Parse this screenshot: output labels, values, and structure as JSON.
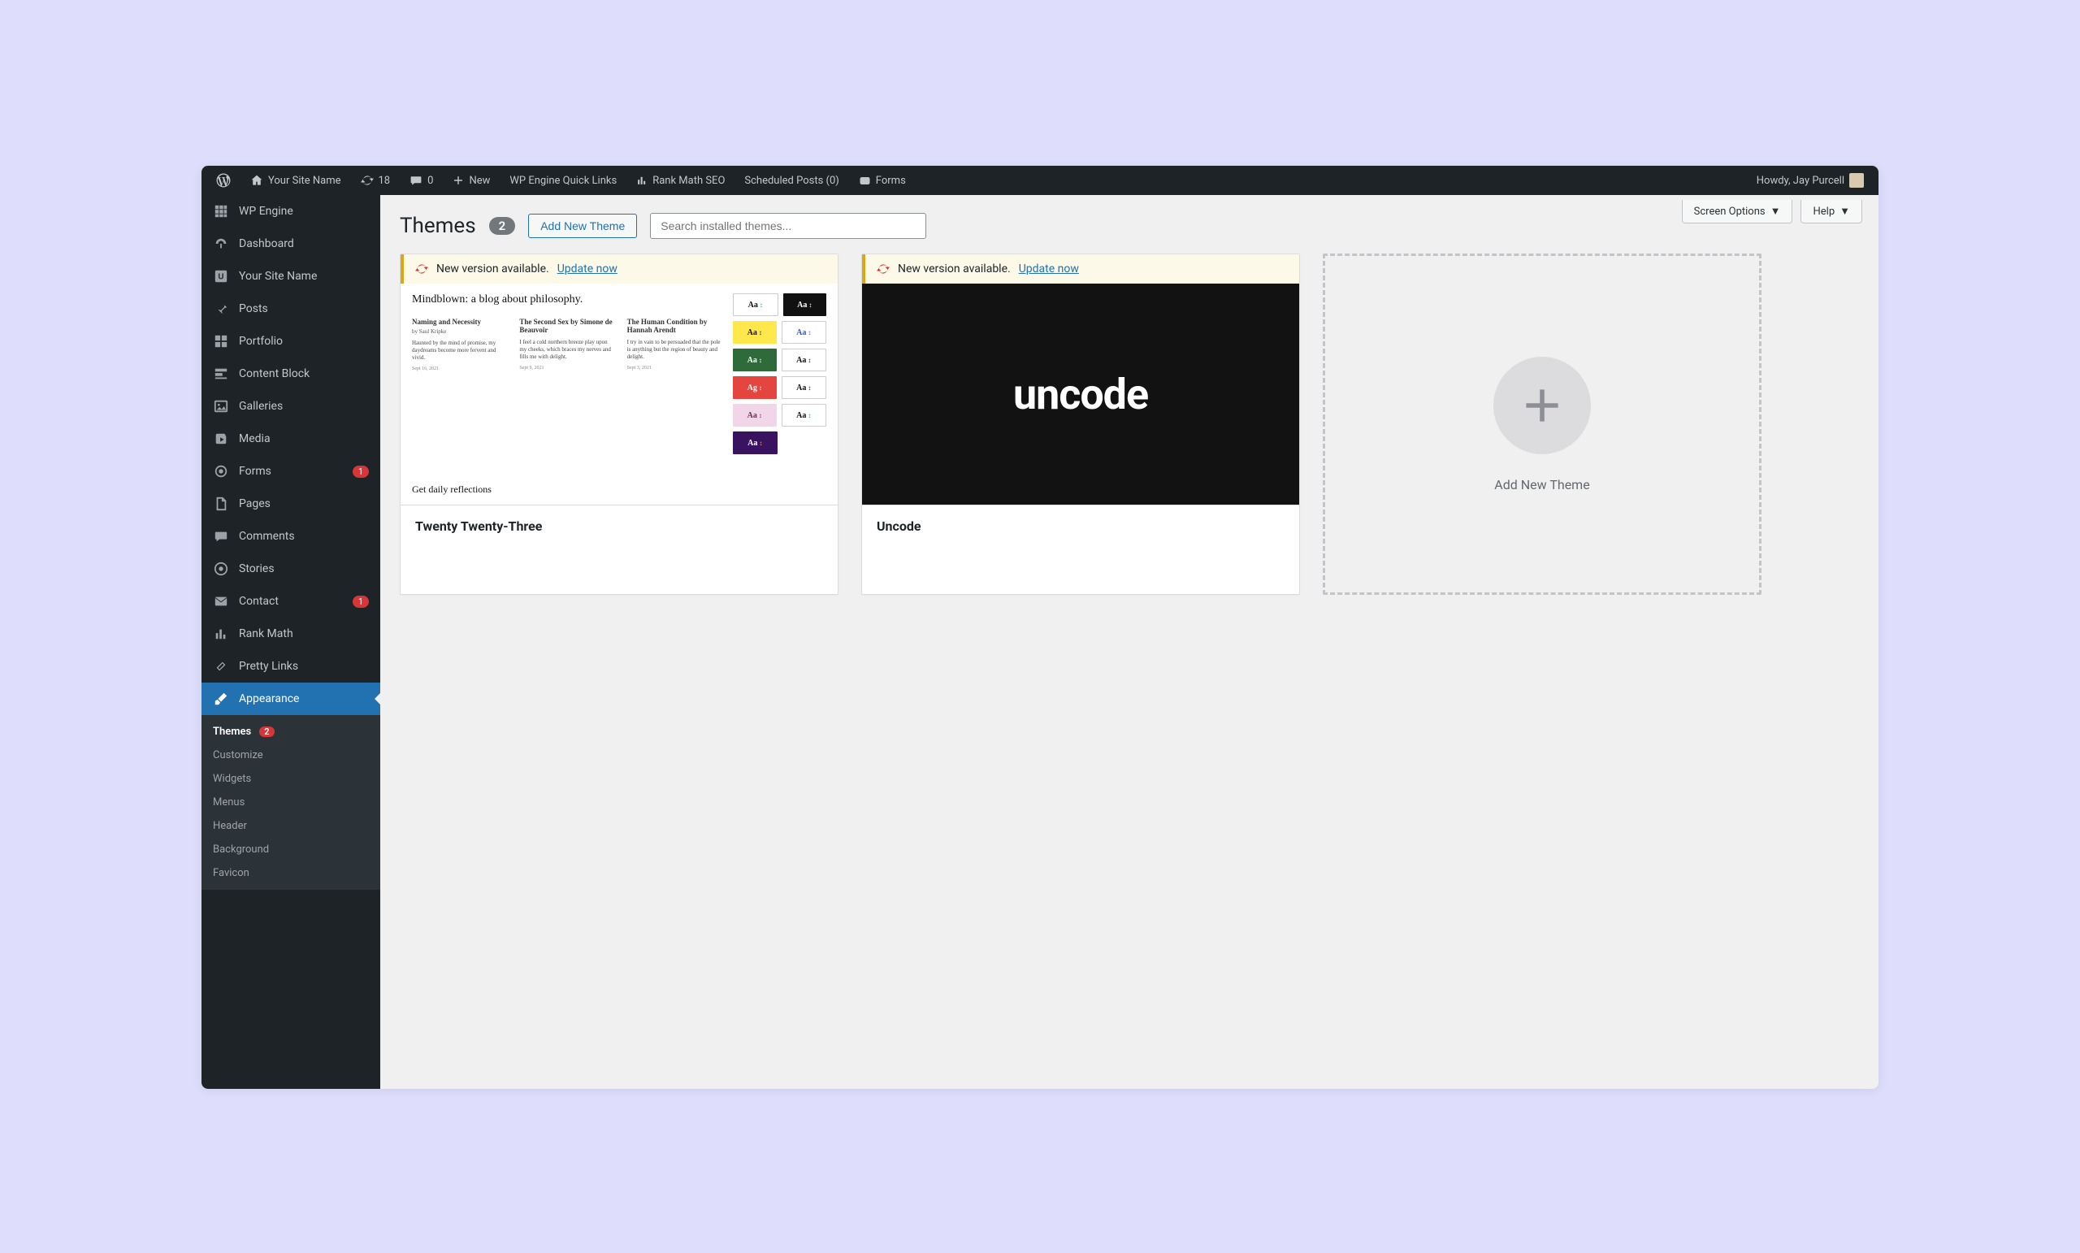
{
  "adminbar": {
    "site_name": "Your Site Name",
    "updates": "18",
    "comments": "0",
    "new": "New",
    "quick_links": "WP Engine Quick Links",
    "rank_math": "Rank Math SEO",
    "scheduled": "Scheduled Posts (0)",
    "forms": "Forms",
    "howdy": "Howdy, Jay Purcell"
  },
  "sidebar": {
    "items": [
      {
        "label": "WP Engine",
        "icon": "wpengine"
      },
      {
        "label": "Dashboard",
        "icon": "dashboard"
      },
      {
        "label": "Your Site Name",
        "icon": "site-letter"
      },
      {
        "label": "Posts",
        "icon": "pin"
      },
      {
        "label": "Portfolio",
        "icon": "grid"
      },
      {
        "label": "Content Block",
        "icon": "blocks"
      },
      {
        "label": "Galleries",
        "icon": "image"
      },
      {
        "label": "Media",
        "icon": "media"
      },
      {
        "label": "Forms",
        "icon": "circle",
        "badge": "1"
      },
      {
        "label": "Pages",
        "icon": "page"
      },
      {
        "label": "Comments",
        "icon": "comment"
      },
      {
        "label": "Stories",
        "icon": "circle-dot"
      },
      {
        "label": "Contact",
        "icon": "mail",
        "badge": "1"
      },
      {
        "label": "Rank Math",
        "icon": "chart"
      },
      {
        "label": "Pretty Links",
        "icon": "link"
      },
      {
        "label": "Appearance",
        "icon": "brush",
        "active": true
      }
    ],
    "submenu": [
      {
        "label": "Themes",
        "current": true,
        "badge": "2"
      },
      {
        "label": "Customize"
      },
      {
        "label": "Widgets"
      },
      {
        "label": "Menus"
      },
      {
        "label": "Header"
      },
      {
        "label": "Background"
      },
      {
        "label": "Favicon"
      }
    ]
  },
  "header": {
    "title": "Themes",
    "count": "2",
    "add_new": "Add New Theme",
    "search_placeholder": "Search installed themes...",
    "screen_options": "Screen Options",
    "help": "Help"
  },
  "themes": [
    {
      "name": "Twenty Twenty-Three",
      "update_text": "New version available.",
      "update_link": "Update now",
      "preview": "tt3"
    },
    {
      "name": "Uncode",
      "update_text": "New version available.",
      "update_link": "Update now",
      "preview": "uncode",
      "preview_text": "uncode"
    }
  ],
  "add_card": {
    "label": "Add New Theme"
  },
  "tt3_preview": {
    "heading": "Mindblown: a blog about philosophy.",
    "cols": [
      {
        "h": "Naming and Necessity",
        "s": "by Saul Kripke",
        "t": "Haunted by the mind of promise, my daydreams become more fervent and vivid.",
        "d": "Sept 16, 2021"
      },
      {
        "h": "The Second Sex by Simone de Beauvoir",
        "s": "",
        "t": "I feel a cold northern breeze play upon my cheeks, which braces my nerves and fills me with delight.",
        "d": "Sept 9, 2021"
      },
      {
        "h": "The Human Condition by Hannah Arendt",
        "s": "",
        "t": "I try in vain to be persuaded that the pole is anything but the region of beauty and delight.",
        "d": "Sept 3, 2021"
      }
    ],
    "daily": "Get daily reflections",
    "swatches": [
      [
        {
          "t": "Aa",
          "bg": "#ffffff",
          "c": "#111",
          "b": "#ccc",
          "arr": "#2a7"
        },
        {
          "t": "Aa",
          "bg": "#111111",
          "c": "#fff",
          "arr": "#fff"
        }
      ],
      [
        {
          "t": "Aa",
          "bg": "#ffe74c",
          "c": "#111",
          "arr": "#111"
        },
        {
          "t": "Aa",
          "bg": "#ffffff",
          "c": "#3456d1",
          "b": "#ccc",
          "arr": "#3456d1"
        }
      ],
      [
        {
          "t": "Aa",
          "bg": "#2f6b3a",
          "c": "#fff",
          "arr": "#fff"
        },
        {
          "t": "Aa",
          "bg": "#ffffff",
          "c": "#111",
          "b": "#ccc",
          "arr": "#111"
        }
      ],
      [
        {
          "t": "Ag",
          "bg": "#e4453f",
          "c": "#fff",
          "arr": "#fff"
        },
        {
          "t": "Aa",
          "bg": "#ffffff",
          "c": "#111",
          "b": "#ccc",
          "arr": "#111",
          "strike": true
        }
      ],
      [
        {
          "t": "Aa",
          "bg": "#f0d6e8",
          "c": "#6b2d5c",
          "arr": "#6b2d5c"
        },
        {
          "t": "Aa",
          "bg": "#ffffff",
          "c": "#111",
          "b": "#ccc",
          "arr": "#2a7"
        }
      ],
      [
        {
          "t": "Aa",
          "bg": "#3a1360",
          "c": "#fff",
          "arr": "#f5a623"
        },
        {
          "t": "",
          "bg": "transparent"
        }
      ]
    ]
  }
}
